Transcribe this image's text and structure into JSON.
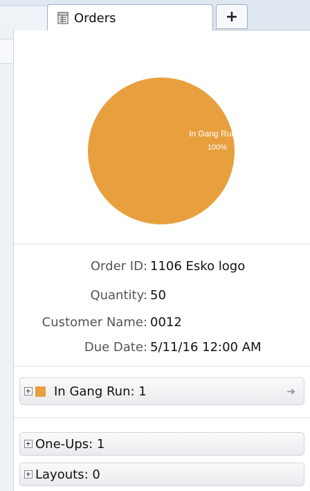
{
  "tabs": {
    "active_label": "Orders",
    "add_label": "+"
  },
  "chart_data": {
    "type": "pie",
    "slices": [
      {
        "label": "In Gang Run",
        "value": 100,
        "value_label": "100%",
        "color": "#e8a03f"
      }
    ]
  },
  "details": {
    "order_id_key": "Order ID:",
    "order_id_value": "1106 Esko logo",
    "quantity_key": "Quantity:",
    "quantity_value": "50",
    "customer_key": "Customer Name:",
    "customer_value": "0012",
    "due_key": "Due Date:",
    "due_value": "5/11/16 12:00 AM"
  },
  "groups": {
    "gang_run_label": "In Gang Run: 1",
    "gang_run_color": "#e8a03f",
    "one_ups_label": "One-Ups: 1",
    "layouts_label": "Layouts: 0"
  },
  "icons": {
    "tab_icon": "spreadsheet-icon",
    "expand_icon": "plus-box-icon",
    "navigate_icon": "right-arrow-icon"
  }
}
